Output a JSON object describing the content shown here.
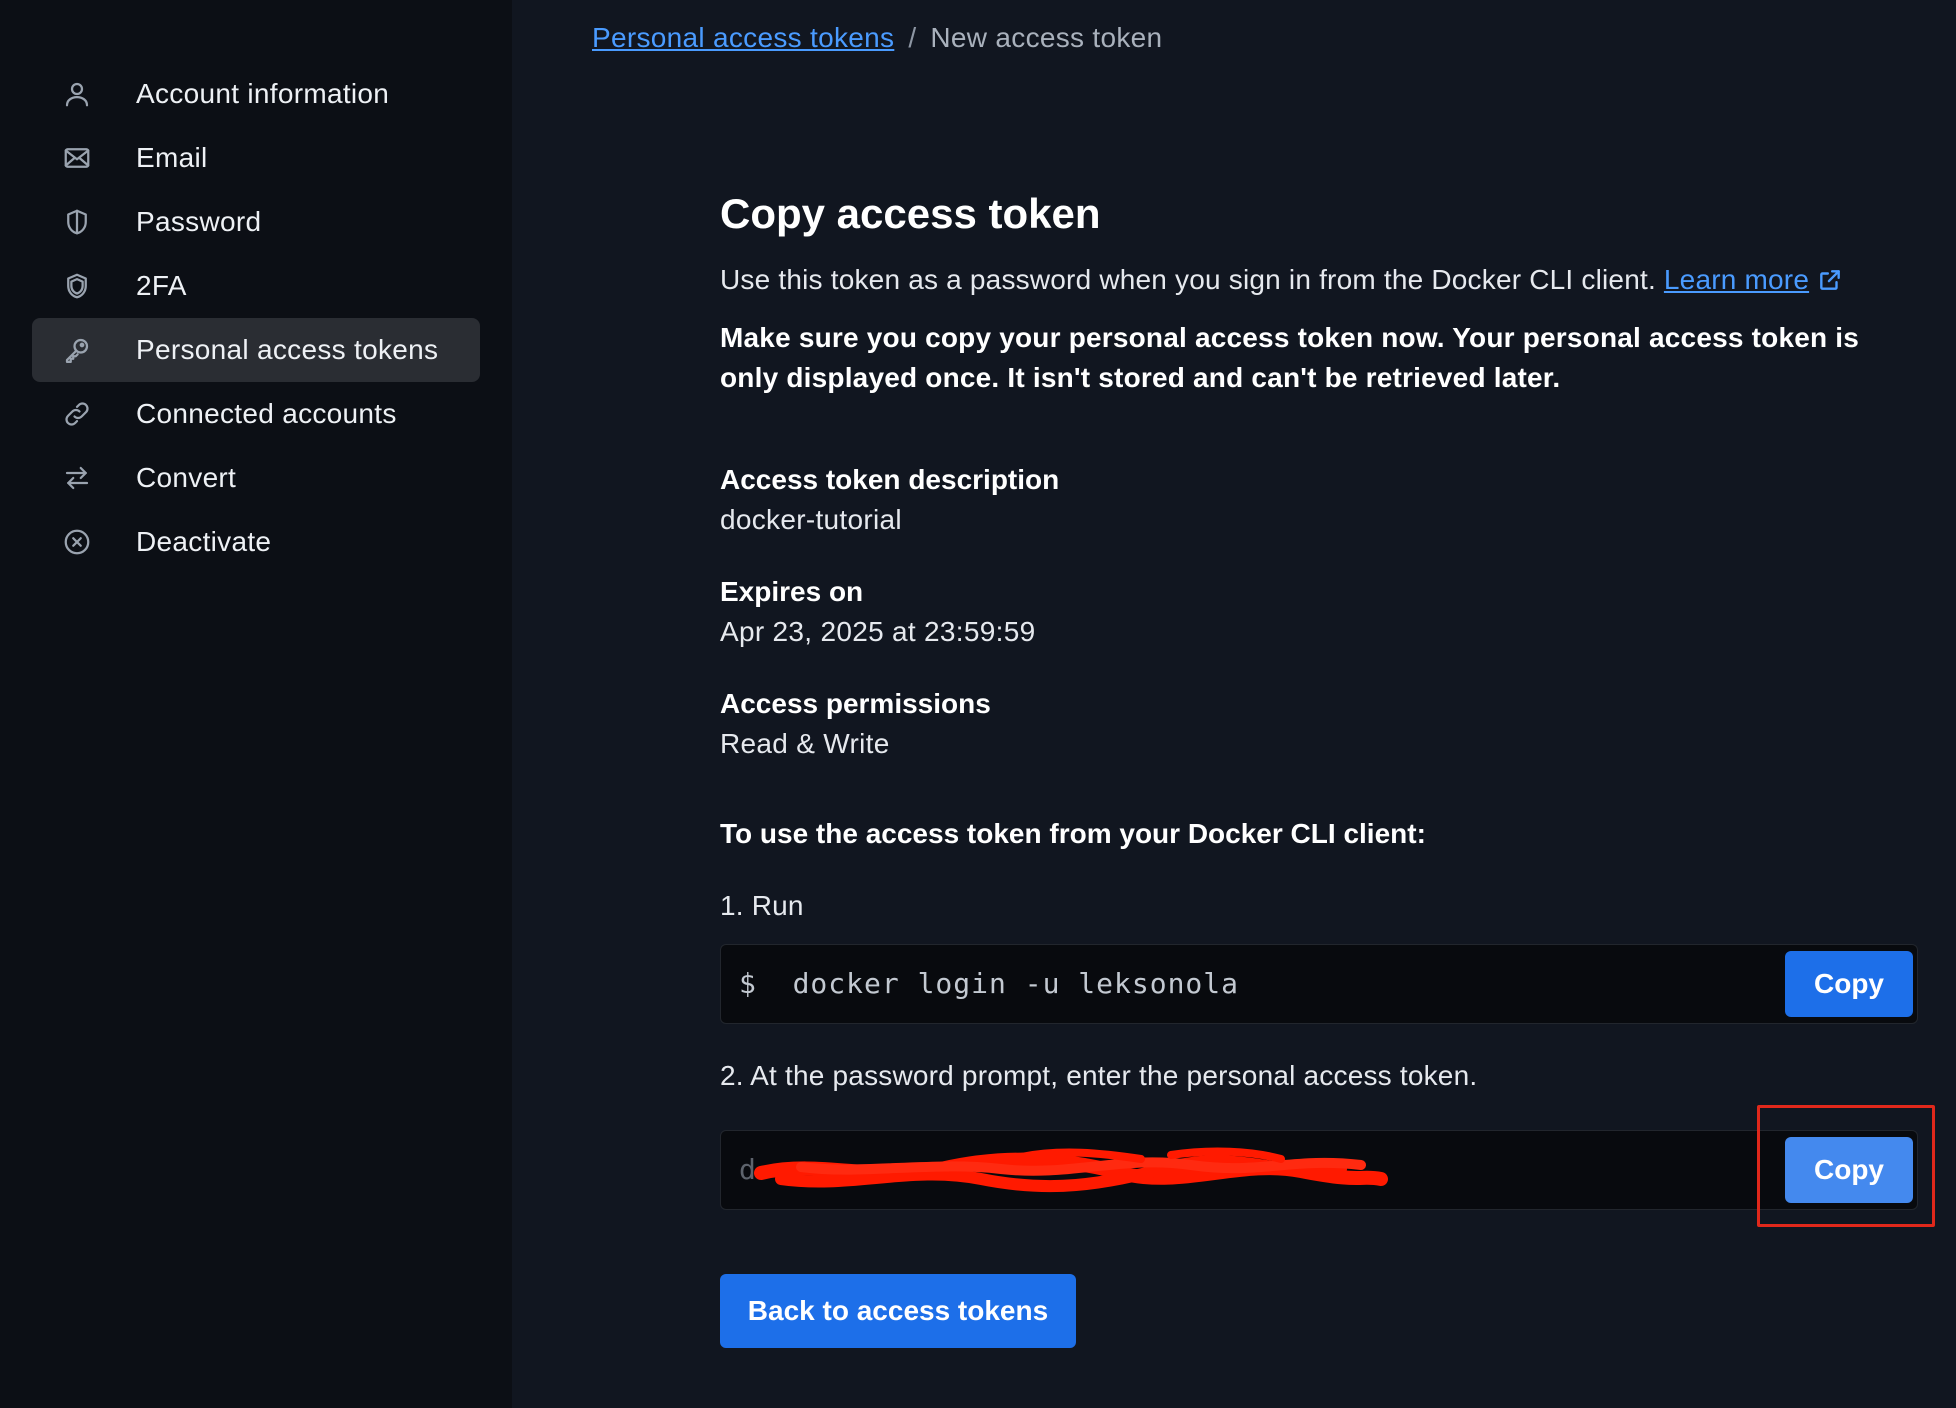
{
  "sidebar": {
    "items": [
      {
        "label": "Account information",
        "icon": "user-icon"
      },
      {
        "label": "Email",
        "icon": "mail-icon"
      },
      {
        "label": "Password",
        "icon": "shield-icon"
      },
      {
        "label": "2FA",
        "icon": "shield-outline-icon"
      },
      {
        "label": "Personal access tokens",
        "icon": "key-icon",
        "active": true
      },
      {
        "label": "Connected accounts",
        "icon": "link-icon"
      },
      {
        "label": "Convert",
        "icon": "swap-arrows-icon"
      },
      {
        "label": "Deactivate",
        "icon": "circle-x-icon"
      }
    ]
  },
  "breadcrumb": {
    "parent": "Personal access tokens",
    "separator": "/",
    "current": "New access token"
  },
  "main": {
    "title": "Copy access token",
    "intro": "Use this token as a password when you sign in from the Docker CLI client.",
    "learn_more": "Learn more",
    "warning": "Make sure you copy your personal access token now. Your personal access token is only displayed once. It isn't stored and can't be retrieved later.",
    "fields": {
      "description_label": "Access token description",
      "description_value": "docker-tutorial",
      "expires_label": "Expires on",
      "expires_value": "Apr 23, 2025 at 23:59:59",
      "permissions_label": "Access permissions",
      "permissions_value": "Read & Write"
    },
    "instructions_heading": "To use the access token from your Docker CLI client:",
    "step1": "1. Run",
    "command": "$  docker login -u leksonola",
    "step2": "2. At the password prompt, enter the personal access token.",
    "token_prefix": "d",
    "copy_label": "Copy",
    "back_button": "Back to access tokens"
  },
  "colors": {
    "accent": "#1d6fe9",
    "link": "#4a9bff",
    "highlight": "#e0281b",
    "redaction": "#ff1a00"
  }
}
